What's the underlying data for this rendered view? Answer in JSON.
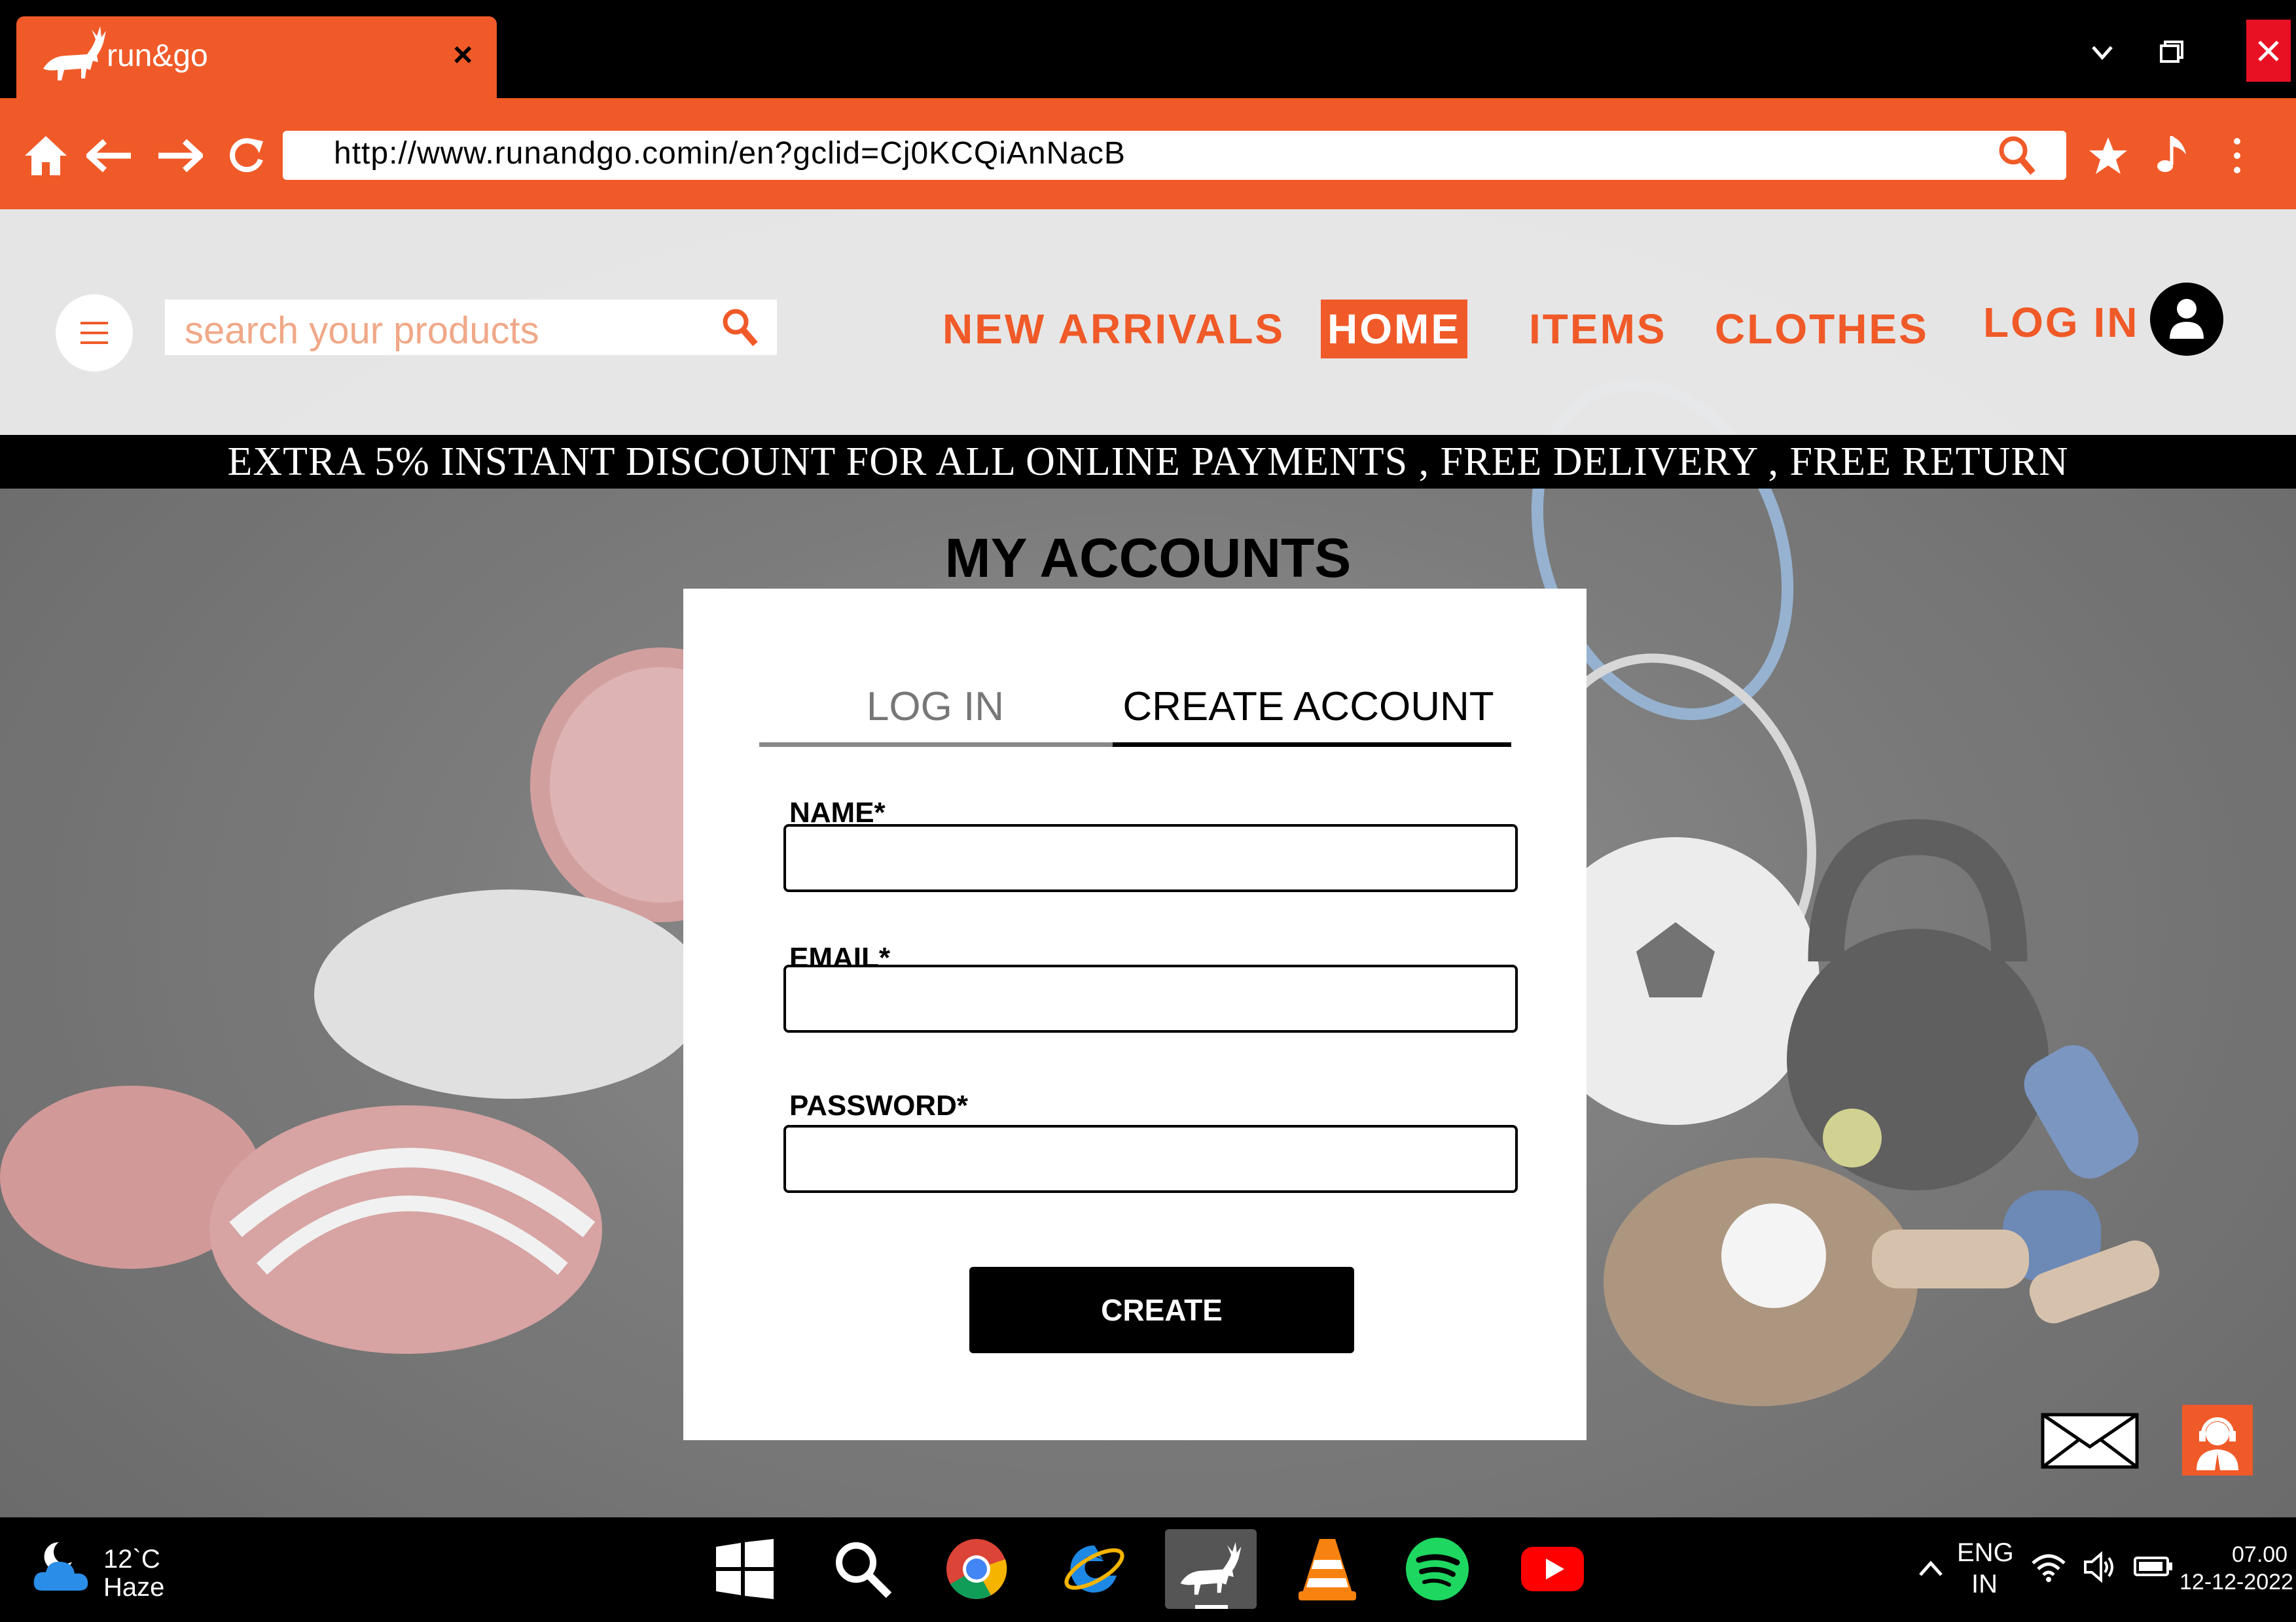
{
  "browser": {
    "tab_title": "run&go",
    "tab_close": "×",
    "url": "http://www.runandgo.comin/en?gclid=Cj0KCQiAnNacB"
  },
  "header": {
    "search_placeholder": "search your products",
    "nav": {
      "new_arrivals": "NEW ARRIVALS",
      "home": "HOME",
      "items": "ITEMS",
      "clothes": "CLOTHES",
      "login": "LOG IN"
    }
  },
  "promo": "EXTRA 5% INSTANT DISCOUNT FOR ALL ONLINE PAYMENTS , FREE DELIVERY , FREE RETURN",
  "account": {
    "heading": "MY ACCOUNTS",
    "tabs": {
      "login": "LOG IN",
      "create": "CREATE ACCOUNT",
      "active": "CREATE ACCOUNT"
    },
    "fields": {
      "name_label": "NAME*",
      "name_value": "",
      "email_label": "EMAIL*",
      "email_value": "",
      "password_label": "PASSWORD*",
      "password_value": ""
    },
    "create_label": "CREATE"
  },
  "taskbar": {
    "weather_temp": "12`C",
    "weather_desc": "Haze",
    "lang_1": "ENG",
    "lang_2": "IN",
    "time": "07.00",
    "date": "12-12-2022"
  },
  "colors": {
    "accent": "#f05a28",
    "close": "#e81123"
  },
  "icons": [
    "home-icon",
    "back-arrow-icon",
    "forward-arrow-icon",
    "reload-icon",
    "search-icon",
    "star-icon",
    "music-note-icon",
    "more-vertical-icon",
    "hamburger-menu-icon",
    "user-avatar-icon",
    "mail-icon",
    "customer-support-icon",
    "windows-start-icon",
    "chrome-icon",
    "internet-explorer-icon",
    "vlc-icon",
    "spotify-icon",
    "youtube-icon",
    "wifi-icon",
    "volume-icon",
    "battery-icon",
    "chevron-up-icon",
    "weather-cloud-icon"
  ]
}
